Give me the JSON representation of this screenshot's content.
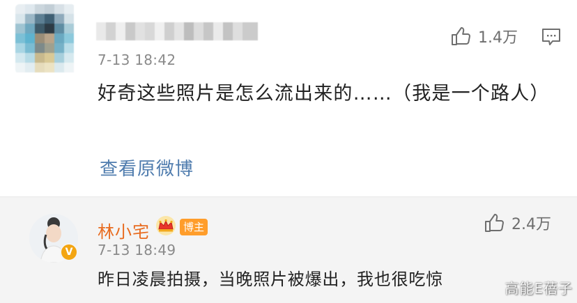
{
  "comment": {
    "time": "7-13 18:42",
    "likes": "1.4万",
    "text": "好奇这些照片是怎么流出来的……（我是一个路人）",
    "view_original": "查看原微博"
  },
  "reply": {
    "author": "林小宅",
    "author_badge": "博主",
    "verified_mark": "V",
    "time": "7-13 18:49",
    "likes": "2.4万",
    "text": "昨日凌晨拍摄，当晚照片被爆出，我也很吃惊"
  },
  "watermark": "高能E蓓子",
  "colors": {
    "link": "#4f7cae",
    "author_name": "#e86b1f",
    "badge_bg": "#ff9d2b",
    "reply_bg": "#f4f4f4"
  },
  "icons": {
    "like": "thumbs-up-icon",
    "reply": "comment-bubble-icon",
    "crown": "crown-icon",
    "verified": "verified-v-icon"
  }
}
